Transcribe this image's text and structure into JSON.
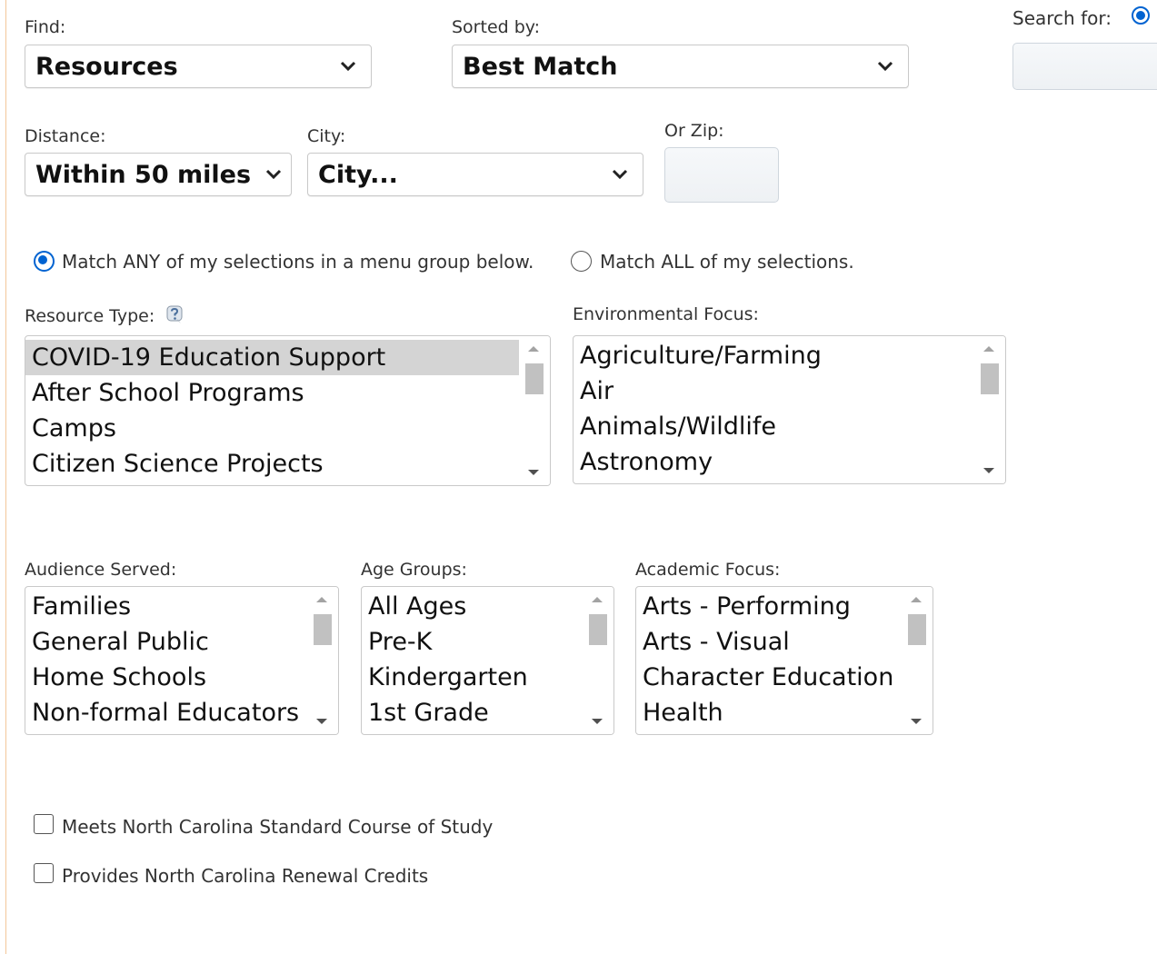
{
  "find": {
    "label": "Find:",
    "value": "Resources"
  },
  "sorted": {
    "label": "Sorted by:",
    "value": "Best Match"
  },
  "search": {
    "label": "Search for:"
  },
  "distance": {
    "label": "Distance:",
    "value": "Within 50 miles"
  },
  "city": {
    "label": "City:",
    "value": "City..."
  },
  "zip": {
    "label": "Or Zip:",
    "value": ""
  },
  "match": {
    "any_label": "Match ANY of my selections in a menu group below.",
    "all_label": "Match ALL of my selections."
  },
  "resource_type": {
    "label": "Resource Type:",
    "help_icon": "help-question-icon",
    "options": [
      "COVID-19 Education Support",
      "After School Programs",
      "Camps",
      "Citizen Science Projects"
    ],
    "selected_index": 0
  },
  "environmental_focus": {
    "label": "Environmental Focus:",
    "options": [
      "Agriculture/Farming",
      "Air",
      "Animals/Wildlife",
      "Astronomy"
    ]
  },
  "audience_served": {
    "label": "Audience Served:",
    "options": [
      "Families",
      "General Public",
      "Home Schools",
      "Non-formal Educators"
    ]
  },
  "age_groups": {
    "label": "Age Groups:",
    "options": [
      "All Ages",
      "Pre-K",
      "Kindergarten",
      "1st Grade"
    ]
  },
  "academic_focus": {
    "label": "Academic Focus:",
    "options": [
      "Arts - Performing",
      "Arts - Visual",
      "Character Education",
      "Health"
    ]
  },
  "checks": {
    "nc_standard": "Meets North Carolina Standard Course of Study",
    "nc_renewal": "Provides North Carolina Renewal Credits"
  },
  "colors": {
    "accent": "#0063d1",
    "selected_option_bg": "#d4d4d4",
    "left_rule": "#f3c79a"
  }
}
